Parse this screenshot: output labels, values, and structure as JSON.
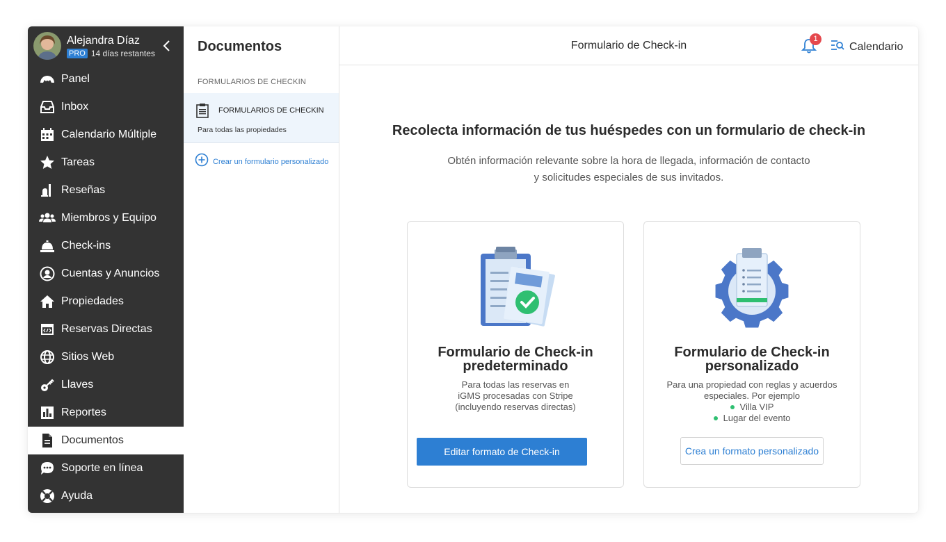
{
  "profile": {
    "name": "Alejandra Díaz",
    "plan_badge": "PRO",
    "days_left": "14 días restantes"
  },
  "sidebar": {
    "items": [
      {
        "label": "Panel",
        "icon": "dashboard-icon"
      },
      {
        "label": "Inbox",
        "icon": "inbox-icon"
      },
      {
        "label": "Calendario Múltiple",
        "icon": "calendar-icon"
      },
      {
        "label": "Tareas",
        "icon": "star-icon"
      },
      {
        "label": "Reseñas",
        "icon": "review-icon"
      },
      {
        "label": "Miembros y Equipo",
        "icon": "team-icon"
      },
      {
        "label": "Check-ins",
        "icon": "service-bell-icon"
      },
      {
        "label": "Cuentas y Anuncios",
        "icon": "user-circle-icon"
      },
      {
        "label": "Propiedades",
        "icon": "home-icon"
      },
      {
        "label": "Reservas Directas",
        "icon": "code-window-icon"
      },
      {
        "label": "Sitios Web",
        "icon": "globe-icon"
      },
      {
        "label": "Llaves",
        "icon": "key-icon"
      },
      {
        "label": "Reportes",
        "icon": "bar-chart-icon"
      },
      {
        "label": "Documentos",
        "icon": "document-icon",
        "active": true
      },
      {
        "label": "Soporte en línea",
        "icon": "chat-icon"
      },
      {
        "label": "Ayuda",
        "icon": "lifebuoy-icon"
      }
    ]
  },
  "mid": {
    "title": "Documentos",
    "section_label": "FORMULARIOS DE CHECKIN",
    "card_title": "FORMULARIOS DE CHECKIN",
    "card_subtitle": "Para todas las propiedades",
    "create_link": "Crear un formulario personalizado"
  },
  "header": {
    "title": "Formulario de Check-in",
    "notification_count": "1",
    "calendar_label": "Calendario"
  },
  "main": {
    "headline": "Recolecta información de tus huéspedes con un formulario de check-in",
    "subline_1": "Obtén información relevante sobre la hora de llegada, información de contacto",
    "subline_2": "y solicitudes especiales de sus invitados.",
    "cards": [
      {
        "title_1": "Formulario de Check-in",
        "title_2": "predeterminado",
        "desc": [
          "Para todas las reservas en",
          "iGMS procesadas con Stripe",
          "(incluyendo reservas directas)"
        ],
        "button": "Editar formato de Check-in"
      },
      {
        "title_1": "Formulario de Check-in",
        "title_2": "personalizado",
        "desc": [
          "Para una propiedad con reglas y acuerdos",
          "especiales. Por ejemplo"
        ],
        "bullets": [
          "Villa VIP",
          "Lugar del evento"
        ],
        "button": "Crea un formato personalizado"
      }
    ]
  },
  "colors": {
    "sidebar_bg": "#333333",
    "accent": "#2d7fd3",
    "badge_red": "#e5484d",
    "bullet_green": "#2fbf71",
    "active_card_bg": "#eef5fc"
  }
}
